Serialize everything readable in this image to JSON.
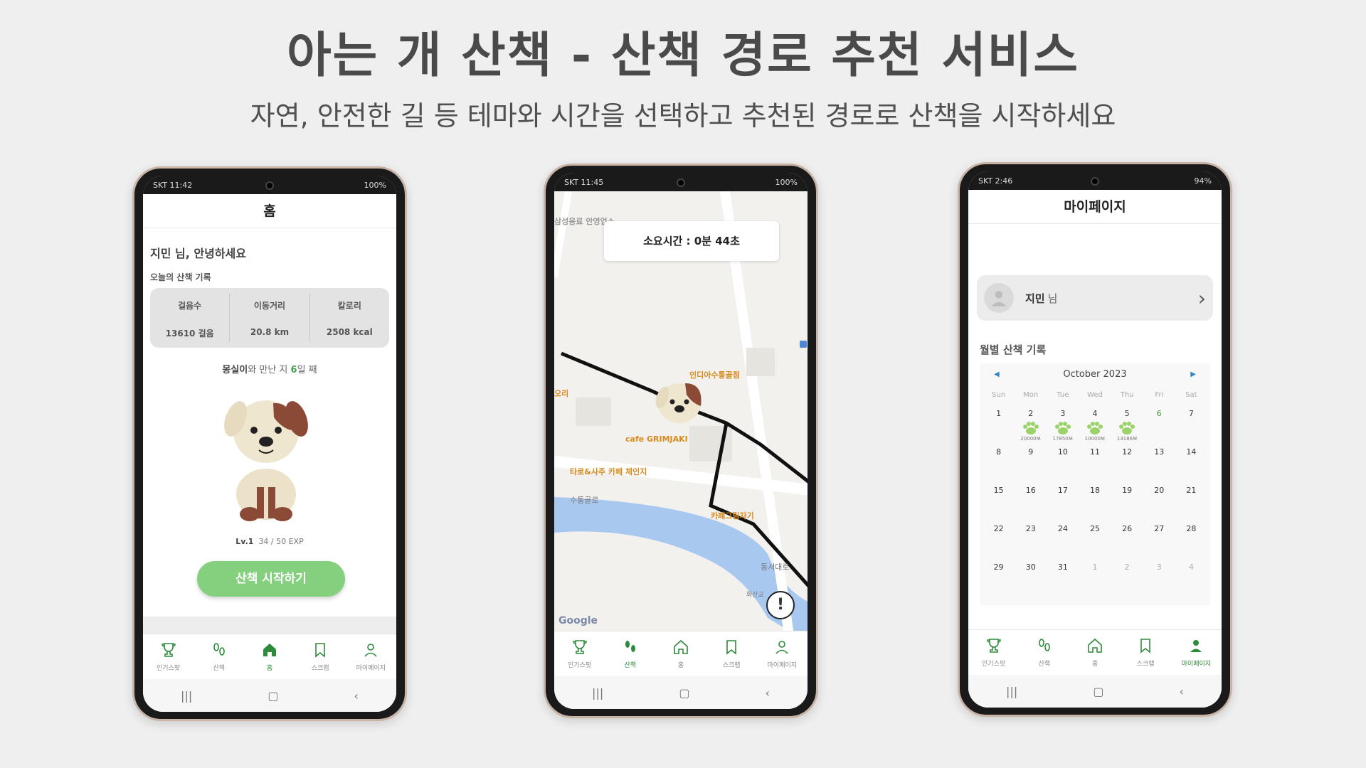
{
  "headline": "아는 개 산책 - 산책 경로 추천 서비스",
  "subline": "자연, 안전한 길  등  테마와 시간을 선택하고  추천된 경로로 산책을 시작하세요",
  "phone1": {
    "status_left": "SKT 11:42",
    "status_right": "100%",
    "title": "홈",
    "greeting": "지민 님, 안녕하세요",
    "today_label": "오늘의 산책 기록",
    "stats": [
      {
        "label": "걸음수",
        "value": "13610 걸음"
      },
      {
        "label": "이동거리",
        "value": "20.8 km"
      },
      {
        "label": "칼로리",
        "value": "2508 kcal"
      }
    ],
    "meet_name": "몽실이",
    "meet_mid": "와 만난 지 ",
    "meet_days": "6",
    "meet_end": "일 째",
    "level": "Lv.1",
    "exp": "34 / 50 EXP",
    "start_button": "산책 시작하기"
  },
  "phone2": {
    "status_left": "SKT 11:45",
    "status_right": "100%",
    "timer": "소요시간 : 0분 44초",
    "labels": {
      "place1": "삼성응료 안영업소",
      "place2": "인디아수통골점",
      "place3": "오리",
      "place4": "cafe GRIMJAKI",
      "place5": "타로&사주 카페 체인지",
      "place6": "카페그림자기",
      "road1": "수통골로",
      "road2": "동서대로",
      "road3": "화산교"
    },
    "google": "Google",
    "alert_symbol": "!"
  },
  "phone3": {
    "status_left": "SKT 2:46",
    "status_right": "94%",
    "title": "마이페이지",
    "profile_name": "지민",
    "profile_suffix": "님",
    "monthly_label": "월별 산책 기록",
    "calendar": {
      "month": "October 2023",
      "weekdays": [
        "Sun",
        "Mon",
        "Tue",
        "Wed",
        "Thu",
        "Fri",
        "Sat"
      ],
      "days": [
        {
          "d": "1"
        },
        {
          "d": "2",
          "steps": "20000보"
        },
        {
          "d": "3",
          "steps": "17850보"
        },
        {
          "d": "4",
          "steps": "10000보"
        },
        {
          "d": "5",
          "steps": "13186보"
        },
        {
          "d": "6",
          "green": true
        },
        {
          "d": "7"
        },
        {
          "d": "8"
        },
        {
          "d": "9"
        },
        {
          "d": "10"
        },
        {
          "d": "11"
        },
        {
          "d": "12"
        },
        {
          "d": "13"
        },
        {
          "d": "14"
        },
        {
          "d": "15"
        },
        {
          "d": "16"
        },
        {
          "d": "17"
        },
        {
          "d": "18"
        },
        {
          "d": "19"
        },
        {
          "d": "20"
        },
        {
          "d": "21"
        },
        {
          "d": "22"
        },
        {
          "d": "23"
        },
        {
          "d": "24"
        },
        {
          "d": "25"
        },
        {
          "d": "26"
        },
        {
          "d": "27"
        },
        {
          "d": "28"
        },
        {
          "d": "29"
        },
        {
          "d": "30"
        },
        {
          "d": "31"
        },
        {
          "d": "1",
          "other": true
        },
        {
          "d": "2",
          "other": true
        },
        {
          "d": "3",
          "other": true
        },
        {
          "d": "4",
          "other": true
        }
      ]
    }
  },
  "nav": [
    "인기스팟",
    "산책",
    "홈",
    "스크랩",
    "마이페이지"
  ],
  "colors": {
    "accent": "#2e8b3a",
    "button": "#85d07f",
    "route": "#111111",
    "water": "#a8c8f0"
  }
}
